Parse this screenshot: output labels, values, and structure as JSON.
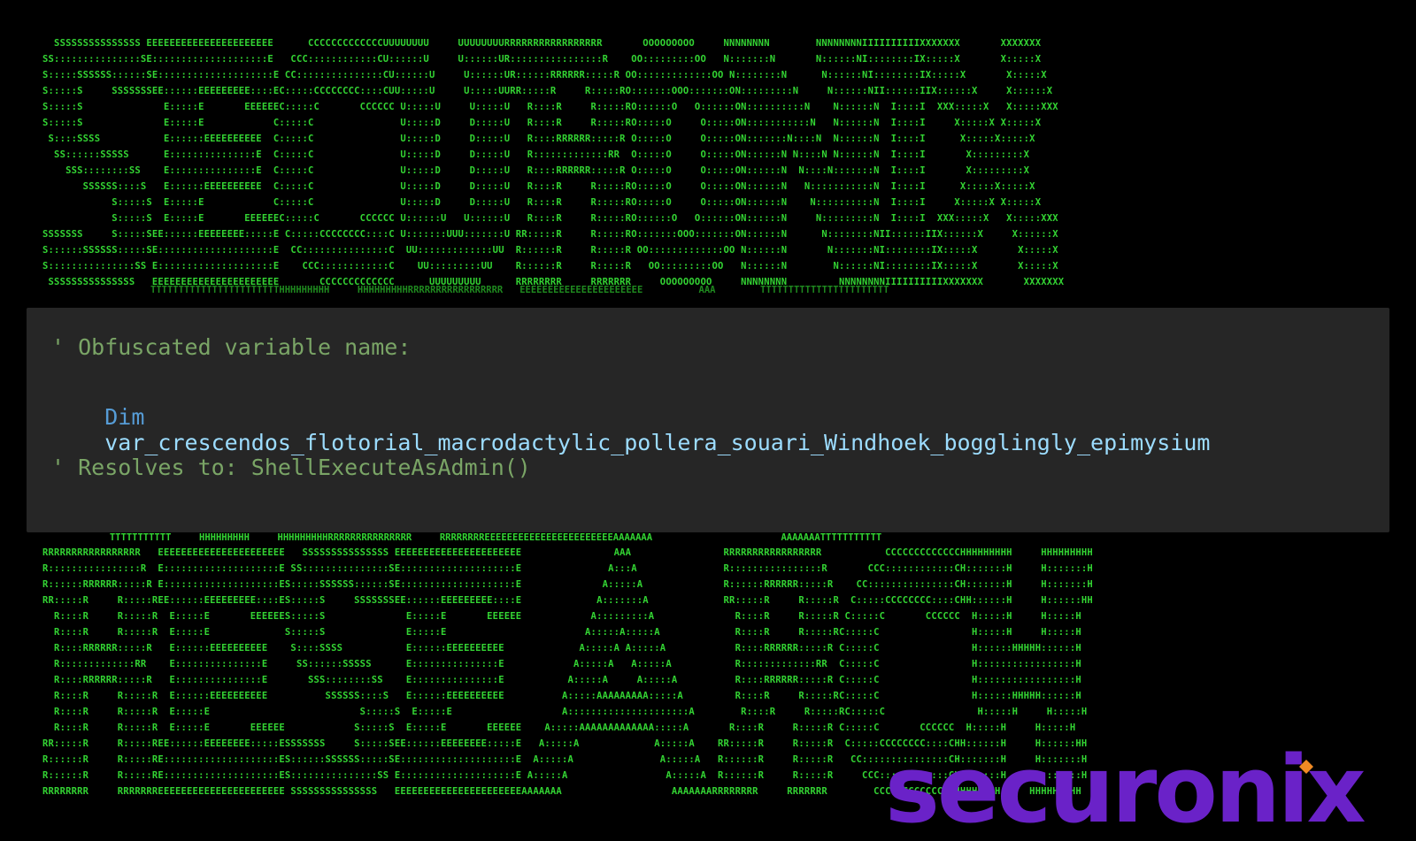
{
  "ascii_top": {
    "lines": [
      "  SSSSSSSSSSSSSSS EEEEEEEEEEEEEEEEEEEEEE      CCCCCCCCCCCCCUUUUUUUU     UUUUUUUURRRRRRRRRRRRRRRRR       OOOOOOOOO     NNNNNNNN        NNNNNNNNIIIIIIIIIIXXXXXXX       XXXXXXX",
      "SS:::::::::::::::SE::::::::::::::::::::E   CCC::::::::::::CU::::::U     U::::::UR::::::::::::::::R    OO:::::::::OO   N:::::::N       N::::::NI::::::::IX:::::X       X:::::X",
      "S:::::SSSSSS::::::SE::::::::::::::::::::E CC:::::::::::::::CU::::::U     U::::::UR::::::RRRRRR:::::R OO:::::::::::::OO N::::::::N      N::::::NI::::::::IX:::::X       X:::::X",
      "S:::::S     SSSSSSSEE::::::EEEEEEEEE::::EC:::::CCCCCCCC::::CUU:::::U     U:::::UURR:::::R     R:::::RO:::::::OOO:::::::ON:::::::::N     N::::::NII::::::IIX::::::X     X::::::X",
      "S:::::S              E:::::E       EEEEEEC:::::C       CCCCCC U:::::U     U:::::U   R::::R     R:::::RO::::::O   O::::::ON::::::::::N    N::::::N  I::::I  XXX:::::X   X:::::XXX",
      "S:::::S              E:::::E            C:::::C               U:::::D     D:::::U   R::::R     R:::::RO:::::O     O:::::ON:::::::::::N   N::::::N  I::::I     X:::::X X:::::X",
      " S::::SSSS           E::::::EEEEEEEEEE  C:::::C               U:::::D     D:::::U   R::::RRRRRR:::::R O:::::O     O:::::ON:::::::N::::N  N::::::N  I::::I      X:::::X:::::X",
      "  SS::::::SSSSS      E:::::::::::::::E  C:::::C               U:::::D     D:::::U   R:::::::::::::RR  O:::::O     O:::::ON::::::N N::::N N::::::N  I::::I       X:::::::::X",
      "    SSS::::::::SS    E:::::::::::::::E  C:::::C               U:::::D     D:::::U   R::::RRRRRR:::::R O:::::O     O:::::ON::::::N  N::::N:::::::N  I::::I       X:::::::::X",
      "       SSSSSS::::S   E::::::EEEEEEEEEE  C:::::C               U:::::D     D:::::U   R::::R     R:::::RO:::::O     O:::::ON::::::N   N:::::::::::N  I::::I      X:::::X:::::X",
      "            S:::::S  E:::::E            C:::::C               U:::::D     D:::::U   R::::R     R:::::RO:::::O     O:::::ON::::::N    N::::::::::N  I::::I     X:::::X X:::::X",
      "            S:::::S  E:::::E       EEEEEEC:::::C       CCCCCC U::::::U   U::::::U   R::::R     R:::::RO::::::O   O::::::ON::::::N     N:::::::::N  I::::I  XXX:::::X   X:::::XXX",
      "SSSSSSS     S:::::SEE::::::EEEEEEEE:::::E C:::::CCCCCCCC::::C U:::::::UUU:::::::U RR:::::R     R:::::RO:::::::OOO:::::::ON::::::N      N::::::::NII::::::IIX::::::X     X::::::X",
      "S::::::SSSSSS:::::SE::::::::::::::::::::E  CC:::::::::::::::C  UU:::::::::::::UU  R::::::R     R:::::R OO:::::::::::::OO N::::::N       N:::::::NI::::::::IX:::::X       X:::::X",
      "S:::::::::::::::SS E::::::::::::::::::::E    CCC::::::::::::C    UU:::::::::UU    R::::::R     R:::::R   OO:::::::::OO   N::::::N        N::::::NI::::::::IX:::::X       X:::::X",
      " SSSSSSSSSSSSSSS   EEEEEEEEEEEEEEEEEEEEEE       CCCCCCCCCCCCC      UUUUUUUUU      RRRRRRRR     RRRRRRR     OOOOOOOOO     NNNNNNNN         NNNNNNNNIIIIIIIIIIXXXXXXX       XXXXXXX"
    ],
    "shadow": "TTTTTTTTTTTTTTTTTTTTTTTHHHHHHHHH     HHHHHHHHHRRRRRRRRRRRRRRRRR   EEEEEEEEEEEEEEEEEEEEEE          AAA        TTTTTTTTTTTTTTTTTTTTTTT"
  },
  "ascii_bottom": {
    "shadow": "            TTTTTTTTTTT     HHHHHHHHH     HHHHHHHHHRRRRRRRRRRRRRRR     RRRRRRRREEEEEEEEEEEEEEEEEEEEEEEAAAAAAA                       AAAAAAATTTTTTTTTTT",
    "lines": [
      "RRRRRRRRRRRRRRRRR   EEEEEEEEEEEEEEEEEEEEEE   SSSSSSSSSSSSSSS EEEEEEEEEEEEEEEEEEEEEE                AAA                RRRRRRRRRRRRRRRRR           CCCCCCCCCCCCCHHHHHHHHH     HHHHHHHHH",
      "R::::::::::::::::R  E::::::::::::::::::::E SS:::::::::::::::SE::::::::::::::::::::E               A:::A               R::::::::::::::::R       CCC::::::::::::CH:::::::H     H:::::::H",
      "R::::::RRRRRR:::::R E::::::::::::::::::::ES:::::SSSSSS::::::SE::::::::::::::::::::E              A:::::A              R::::::RRRRRR:::::R    CC:::::::::::::::CH:::::::H     H:::::::H",
      "RR:::::R     R:::::REE::::::EEEEEEEEE::::ES:::::S     SSSSSSSEE::::::EEEEEEEEE::::E             A:::::::A             RR:::::R     R:::::R  C:::::CCCCCCCC::::CHH::::::H     H::::::HH",
      "  R::::R     R:::::R  E:::::E       EEEEEES:::::S              E:::::E       EEEEEE            A:::::::::A              R::::R     R:::::R C:::::C       CCCCCC  H:::::H     H:::::H",
      "  R::::R     R:::::R  E:::::E             S:::::S              E:::::E                        A:::::A:::::A             R::::R     R:::::RC:::::C                H:::::H     H:::::H",
      "  R::::RRRRRR:::::R   E::::::EEEEEEEEEE    S::::SSSS           E::::::EEEEEEEEEE             A:::::A A:::::A            R::::RRRRRR:::::R C:::::C                H::::::HHHHH::::::H",
      "  R:::::::::::::RR    E:::::::::::::::E     SS::::::SSSSS      E:::::::::::::::E            A:::::A   A:::::A           R:::::::::::::RR  C:::::C                H:::::::::::::::::H",
      "  R::::RRRRRR:::::R   E:::::::::::::::E       SSS::::::::SS    E:::::::::::::::E           A:::::A     A:::::A          R::::RRRRRR:::::R C:::::C                H:::::::::::::::::H",
      "  R::::R     R:::::R  E::::::EEEEEEEEEE          SSSSSS::::S   E::::::EEEEEEEEEE          A:::::AAAAAAAAA:::::A         R::::R     R:::::RC:::::C                H::::::HHHHH::::::H",
      "  R::::R     R:::::R  E:::::E                          S:::::S  E:::::E                   A:::::::::::::::::::::A        R::::R     R:::::RC:::::C                H:::::H     H:::::H",
      "  R::::R     R:::::R  E:::::E       EEEEEE            S:::::S  E:::::E       EEEEEE    A:::::AAAAAAAAAAAAA:::::A       R::::R     R:::::R C:::::C       CCCCCC  H:::::H     H:::::H",
      "RR:::::R     R:::::REE::::::EEEEEEEE:::::ESSSSSSS     S:::::SEE::::::EEEEEEEE:::::E   A:::::A             A:::::A    RR:::::R     R:::::R  C:::::CCCCCCCC::::CHH::::::H     H::::::HH",
      "R::::::R     R:::::RE::::::::::::::::::::ES::::::SSSSSS:::::SE::::::::::::::::::::E  A:::::A               A:::::A   R::::::R     R:::::R   CC:::::::::::::::CH:::::::H     H:::::::H",
      "R::::::R     R:::::RE::::::::::::::::::::ES:::::::::::::::SS E::::::::::::::::::::E A:::::A                 A:::::A  R::::::R     R:::::R     CCC::::::::::::CH:::::::H     H:::::::H",
      "RRRRRRRR     RRRRRRREEEEEEEEEEEEEEEEEEEEEE SSSSSSSSSSSSSSS   EEEEEEEEEEEEEEEEEEEEEEAAAAAAA                   AAAAAAARRRRRRRR     RRRRRRR        CCCCCCCCCCCCCHHHHHHHHH     HHHHHHHHH"
    ]
  },
  "code_panel": {
    "line1_comment": "' Obfuscated variable name:",
    "line2_keyword": "Dim",
    "line2_identifier": "var_crescendos_flotorial_macrodactylic_pollera_souari_Windhoek_bogglingly_epimysium",
    "line3_comment": "' Resolves to: ShellExecuteAsAdmin()"
  },
  "logo": {
    "text": "securonix",
    "accent_color": "#6a22c8",
    "dot_color": "#f08a24"
  },
  "colors": {
    "background": "#000000",
    "ascii_green": "#33d433",
    "panel_bg": "#262626",
    "comment": "#7aa566",
    "keyword": "#569cd6",
    "identifier": "#9cdcfe"
  }
}
